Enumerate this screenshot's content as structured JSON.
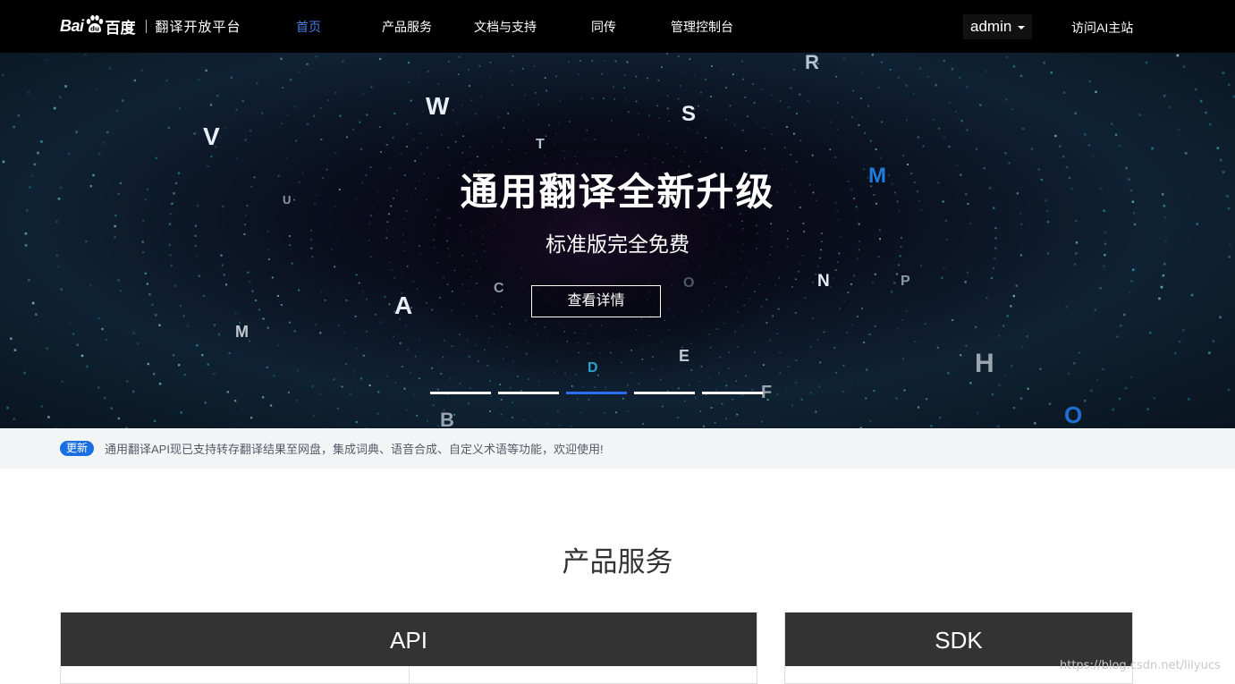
{
  "header": {
    "logo_bai": "Bai",
    "logo_du": "百度",
    "logo_title": "翻译开放平台",
    "nav": [
      {
        "label": "首页",
        "active": true
      },
      {
        "label": "产品服务",
        "active": false
      },
      {
        "label": "文档与支持",
        "active": false
      },
      {
        "label": "同传",
        "active": false
      },
      {
        "label": "管理控制台",
        "active": false
      }
    ],
    "user": "admin",
    "visit_link": "访问AI主站"
  },
  "hero": {
    "title": "通用翻译全新升级",
    "subtitle": "标准版完全免费",
    "button": "查看详情",
    "slides_total": 5,
    "active_slide": 3,
    "decor_letters": [
      "R",
      "W",
      "S",
      "T",
      "V",
      "M",
      "U",
      "A",
      "C",
      "O",
      "N",
      "P",
      "M",
      "D",
      "E",
      "H",
      "B",
      "F",
      "O"
    ]
  },
  "notice": {
    "badge": "更新",
    "text": "通用翻译API现已支持转存翻译结果至网盘，集成词典、语音合成、自定义术语等功能，欢迎使用!"
  },
  "products": {
    "title": "产品服务",
    "cards": [
      {
        "label": "API"
      },
      {
        "label": "SDK"
      }
    ]
  },
  "watermark": "https://blog.csdn.net/lilyucs",
  "colors": {
    "nav_bg": "#000000",
    "active_nav": "#4a7de3",
    "accent": "#2a6ff0",
    "badge": "#1a6fe0",
    "card_head": "#333333",
    "notice_bg": "#f3f4f6"
  }
}
